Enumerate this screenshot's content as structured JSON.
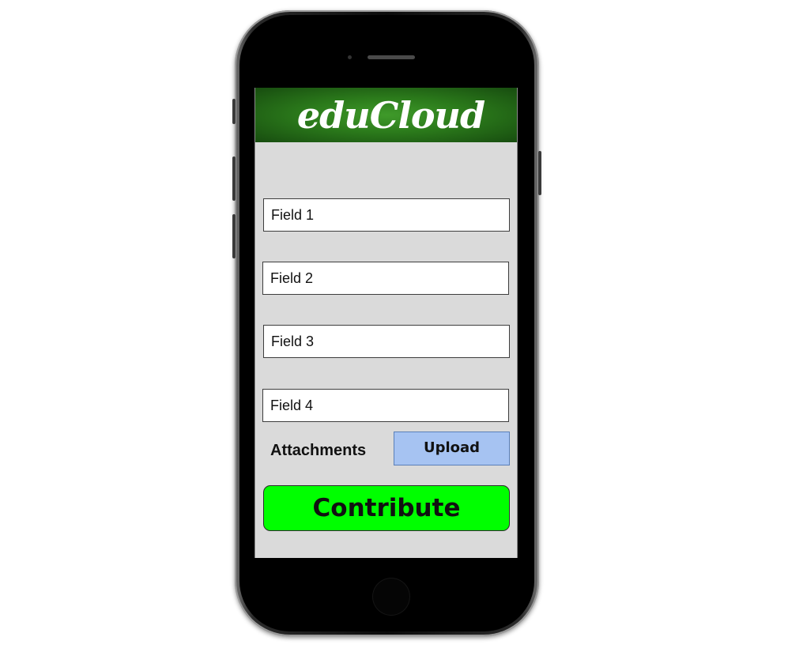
{
  "app": {
    "title": "eduCloud"
  },
  "form": {
    "fields": [
      {
        "value": "Field 1"
      },
      {
        "value": "Field 2"
      },
      {
        "value": "Field 3"
      },
      {
        "value": "Field 4"
      }
    ],
    "attachments_label": "Attachments",
    "upload_label": "Upload",
    "submit_label": "Contribute"
  },
  "colors": {
    "header": "#2b7a1b",
    "screen_background": "#dadada",
    "upload_button": "#a6c3f2",
    "submit_button": "#00ff00"
  }
}
